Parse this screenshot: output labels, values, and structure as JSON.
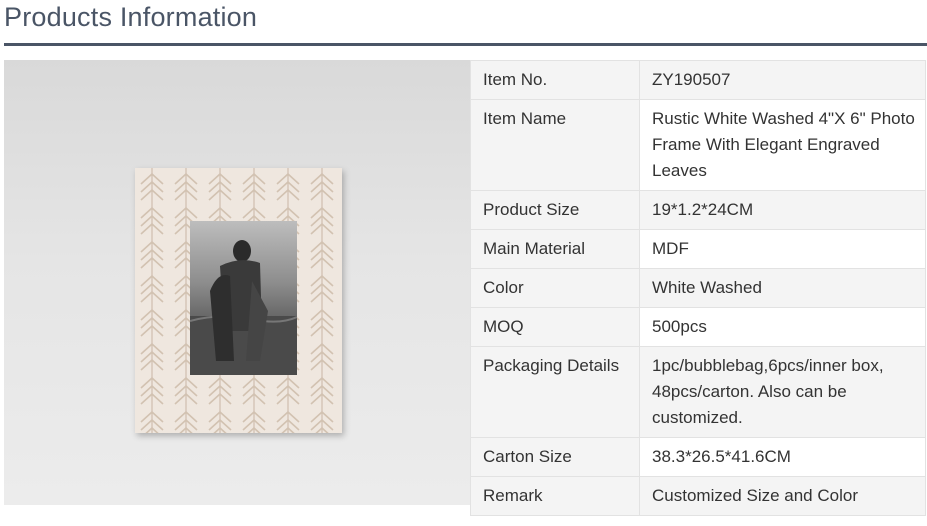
{
  "header": {
    "title": "Products Information"
  },
  "product_image": {
    "alt": "Rustic white washed photo frame with engraved leaves"
  },
  "specs": [
    {
      "label": "Item No.",
      "value": "ZY190507"
    },
    {
      "label": "Item Name",
      "value": "Rustic White Washed 4\"X 6\" Photo Frame With Elegant Engraved Leaves"
    },
    {
      "label": "Product Size",
      "value": "19*1.2*24CM"
    },
    {
      "label": "Main Material",
      "value": "MDF"
    },
    {
      "label": "Color",
      "value": "White Washed"
    },
    {
      "label": "MOQ",
      "value": "500pcs"
    },
    {
      "label": "Packaging Details",
      "value": "1pc/bubblebag,6pcs/inner box, 48pcs/carton. Also can be customized."
    },
    {
      "label": "Carton Size",
      "value": "38.3*26.5*41.6CM"
    },
    {
      "label": "Remark",
      "value": "Customized Size and Color"
    }
  ],
  "colors": {
    "heading": "#4a5566",
    "label_bg": "#f4f4f4",
    "border": "#e2e2e2"
  }
}
